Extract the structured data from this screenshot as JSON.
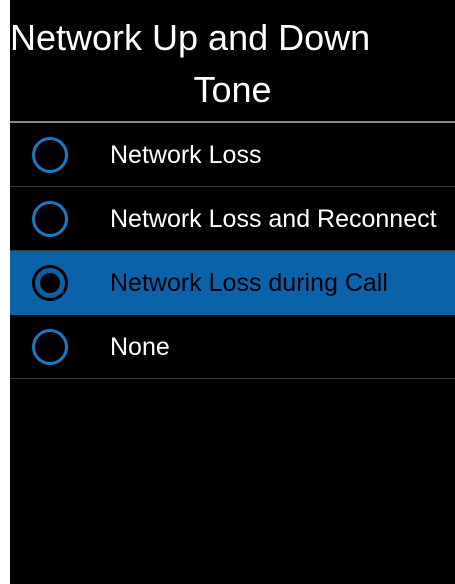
{
  "header": {
    "title_line1": "Network Up and Down",
    "title_line2": "Tone"
  },
  "options": [
    {
      "label": "Network Loss",
      "selected": false
    },
    {
      "label": "Network Loss and Reconnect",
      "selected": false
    },
    {
      "label": "Network Loss during Call",
      "selected": true
    },
    {
      "label": "None",
      "selected": false
    }
  ],
  "colors": {
    "background": "#000000",
    "accent": "#0a63a8",
    "radio_ring": "#1a78c2",
    "text": "#ffffff"
  }
}
